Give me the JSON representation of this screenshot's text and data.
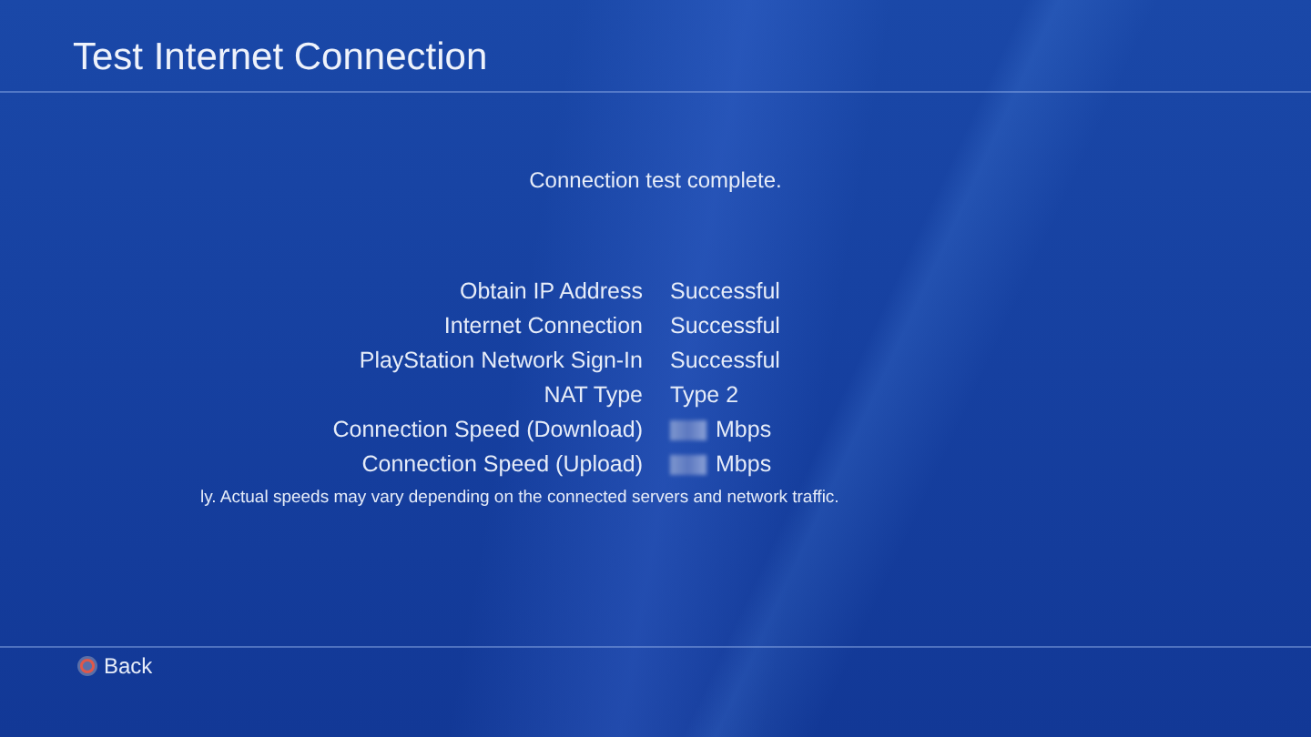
{
  "header": {
    "title": "Test Internet Connection"
  },
  "message": "Connection test complete.",
  "results": [
    {
      "label": "Obtain IP Address",
      "kind": "text",
      "value": "Successful"
    },
    {
      "label": "Internet Connection",
      "kind": "text",
      "value": "Successful"
    },
    {
      "label": "PlayStation Network Sign-In",
      "kind": "text",
      "value": "Successful"
    },
    {
      "label": "NAT Type",
      "kind": "text",
      "value": "Type 2"
    },
    {
      "label": "Connection Speed (Download)",
      "kind": "speed",
      "value": "Mbps"
    },
    {
      "label": "Connection Speed (Upload)",
      "kind": "speed",
      "value": "Mbps"
    }
  ],
  "note": "ly. Actual speeds may vary depending on the connected servers and network traffic.",
  "footer": {
    "back_label": "Back"
  }
}
